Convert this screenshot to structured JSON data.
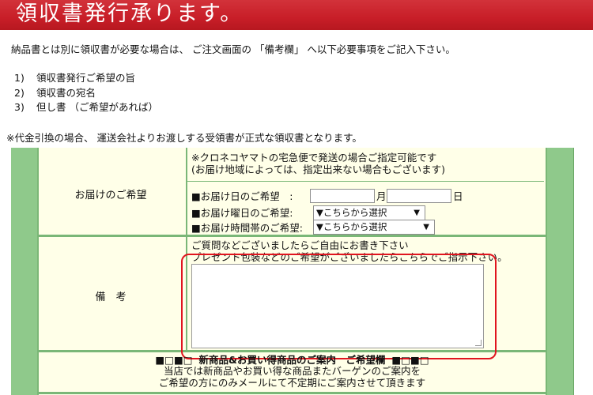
{
  "banner": {
    "title": "領収書発行承ります。"
  },
  "intro": "納品書とは別に領収書が必要な場合は、 ご注文画面の 「備考欄」 へ以下必要事項をご記入下さい。",
  "steps": [
    {
      "num": "1)",
      "text": "領収書発行ご希望の旨"
    },
    {
      "num": "2)",
      "text": "領収書の宛名"
    },
    {
      "num": "3)",
      "text": "但し書 （ご希望があれば）"
    }
  ],
  "note": "※代金引換の場合、 運送会社よりお渡しする受領書が正式な領収書となります。",
  "delivery": {
    "label": "お届けのご希望",
    "info_line1": "※クロネコヤマトの宅急便で発送の場合ご指定可能です",
    "info_line2": "(お届け地域によっては、指定出来ない場合もございます)",
    "date_label": "■お届け日のご希望　:",
    "month_unit": "月",
    "day_unit": "日",
    "weekday_label": "■お届け曜日のご希望:",
    "weekday_select": "▼こちらから選択",
    "time_label": "■お届け時間帯のご希望:",
    "time_select": "▼こちらから選択",
    "select_arrow": "▼"
  },
  "remarks": {
    "label": "備　考",
    "line1": "ご質問などございましたらご自由にお書き下さい",
    "line2": "プレゼント包装などのご希望がございましたらこちらでご指示下さい。",
    "textarea_value": ""
  },
  "promo": {
    "heading_left": "■□■□",
    "heading": "新商品&お買い得商品のご案内　ご希望欄",
    "heading_right": "■□■□",
    "line1": "当店では新商品やお買い得な商品またバーゲンのご案内を",
    "line2": "ご希望の方にのみメールにて不定期にご案内させて頂きます"
  },
  "colors": {
    "banner": "#c81e28",
    "frame": "#8fc98b",
    "cell": "#ffffe8",
    "highlight": "#e0141e"
  }
}
